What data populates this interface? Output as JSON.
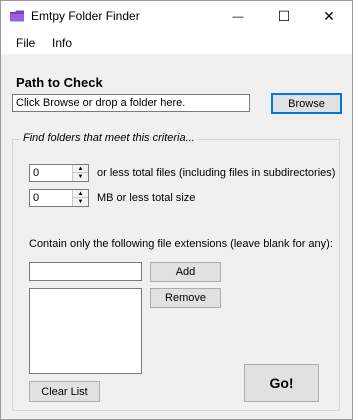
{
  "window": {
    "title": "Emtpy Folder Finder",
    "minimize_glyph": "—",
    "maximize_glyph": "☐",
    "close_glyph": "✕"
  },
  "menu": {
    "items": [
      "File",
      "Info"
    ]
  },
  "path": {
    "heading": "Path to Check",
    "field_value": "Click Browse or drop a folder here.",
    "browse_label": "Browse"
  },
  "criteria": {
    "legend": "Find folders that meet this criteria...",
    "files_value": "0",
    "files_label": "or less total files (including files in subdirectories)",
    "size_value": "0",
    "size_label": "MB or less total size",
    "extensions_label": "Contain only the following file extensions (leave blank for any):",
    "extension_input_value": "",
    "add_label": "Add",
    "remove_label": "Remove",
    "clear_label": "Clear List",
    "go_label": "Go!"
  },
  "icons": {
    "app": "folder-icon",
    "spin_up": "▲",
    "spin_down": "▼"
  },
  "colors": {
    "accent": "#0078d7",
    "app_icon": "#7b3fc4"
  }
}
